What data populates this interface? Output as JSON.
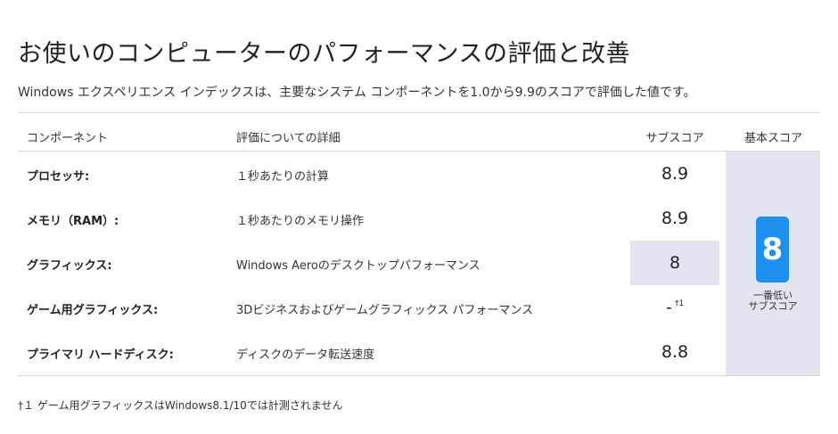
{
  "page": {
    "title": "お使いのコンピューターのパフォーマンスの評価と改善",
    "description": "Windows エクスペリエンス インデックスは、主要なシステム コンポーネントを1.0から9.9のスコアで評価した値です。"
  },
  "table": {
    "headers": {
      "component": "コンポーネント",
      "details": "評価についての詳細",
      "subscore": "サブスコア",
      "basescore": "基本スコア"
    },
    "rows": [
      {
        "name": "プロセッサ:",
        "details": "１秒あたりの計算",
        "subscore": "8.9",
        "note": ""
      },
      {
        "name": "メモリ（RAM）:",
        "details": "１秒あたりのメモリ操作",
        "subscore": "8.9",
        "note": ""
      },
      {
        "name": "グラフィックス:",
        "details": "Windows Aeroのデスクトップパフォーマンス",
        "subscore": "8",
        "note": ""
      },
      {
        "name": "ゲーム用グラフィックス:",
        "details": "3Dビジネスおよびゲームグラフィックス パフォーマンス",
        "subscore": "-",
        "note": "†1"
      },
      {
        "name": "プライマリ ハードディスク:",
        "details": "ディスクのデータ転送速度",
        "subscore": "8.8",
        "note": ""
      }
    ],
    "base_score": {
      "value": "8",
      "label": "一番低い\nサブスコア",
      "color": "#1e90ef"
    },
    "highlight_color": "#e4e4f1"
  },
  "footnote": "†１ ゲーム用グラフィックスはWindows8.1/10では計測されません"
}
